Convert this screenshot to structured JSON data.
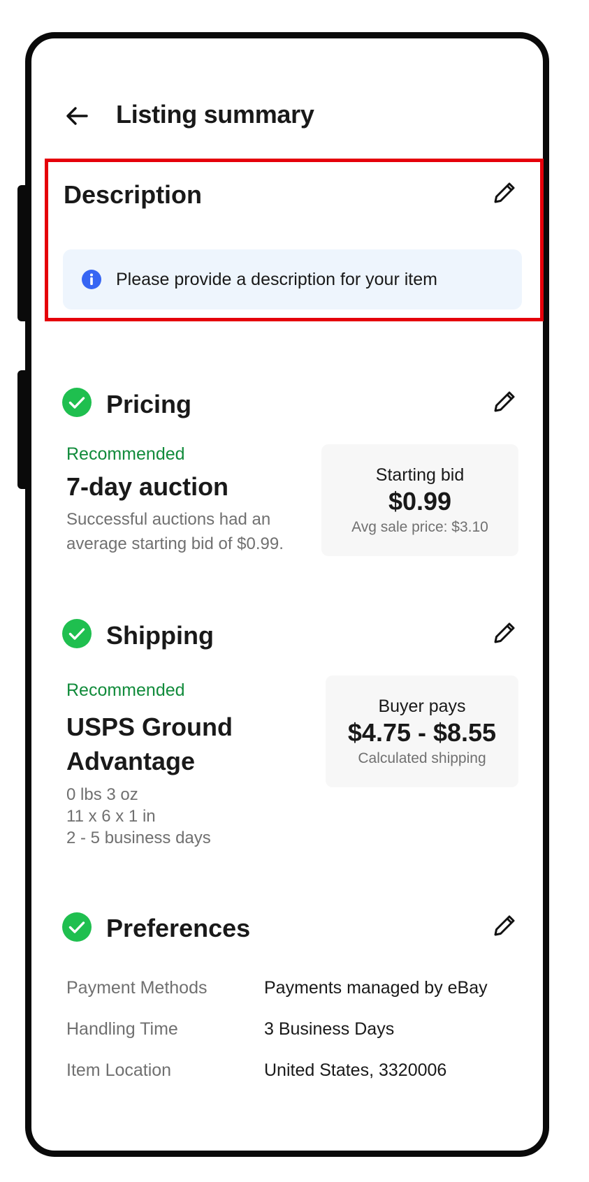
{
  "header": {
    "title": "Listing summary"
  },
  "description": {
    "title": "Description",
    "info_text": "Please provide a description for your item"
  },
  "pricing": {
    "title": "Pricing",
    "recommended": "Recommended",
    "format": "7-day auction",
    "note_line1": "Successful auctions had an",
    "note_line2": "average starting bid of $0.99.",
    "card_label": "Starting bid",
    "card_value": "$0.99",
    "card_sub": "Avg sale price: $3.10"
  },
  "shipping": {
    "title": "Shipping",
    "recommended": "Recommended",
    "service_line1": "USPS Ground",
    "service_line2": "Advantage",
    "weight": "0 lbs 3 oz",
    "dimensions": "11 x 6 x 1 in",
    "delivery": "2 - 5 business days",
    "card_label": "Buyer pays",
    "card_value": "$4.75 - $8.55",
    "card_sub": "Calculated shipping"
  },
  "preferences": {
    "title": "Preferences",
    "rows": [
      {
        "label": "Payment Methods",
        "value": "Payments managed by eBay"
      },
      {
        "label": "Handling Time",
        "value": "3 Business Days"
      },
      {
        "label": "Item Location",
        "value": "United States, 3320006"
      }
    ]
  },
  "colors": {
    "highlight": "#e5000a",
    "success": "#1fbf4f",
    "recommended_text": "#118b3b",
    "info": "#3665f3",
    "info_bg": "#eef5fd"
  },
  "icons": [
    "back-arrow-icon",
    "pencil-icon",
    "info-icon",
    "check-circle-icon"
  ]
}
